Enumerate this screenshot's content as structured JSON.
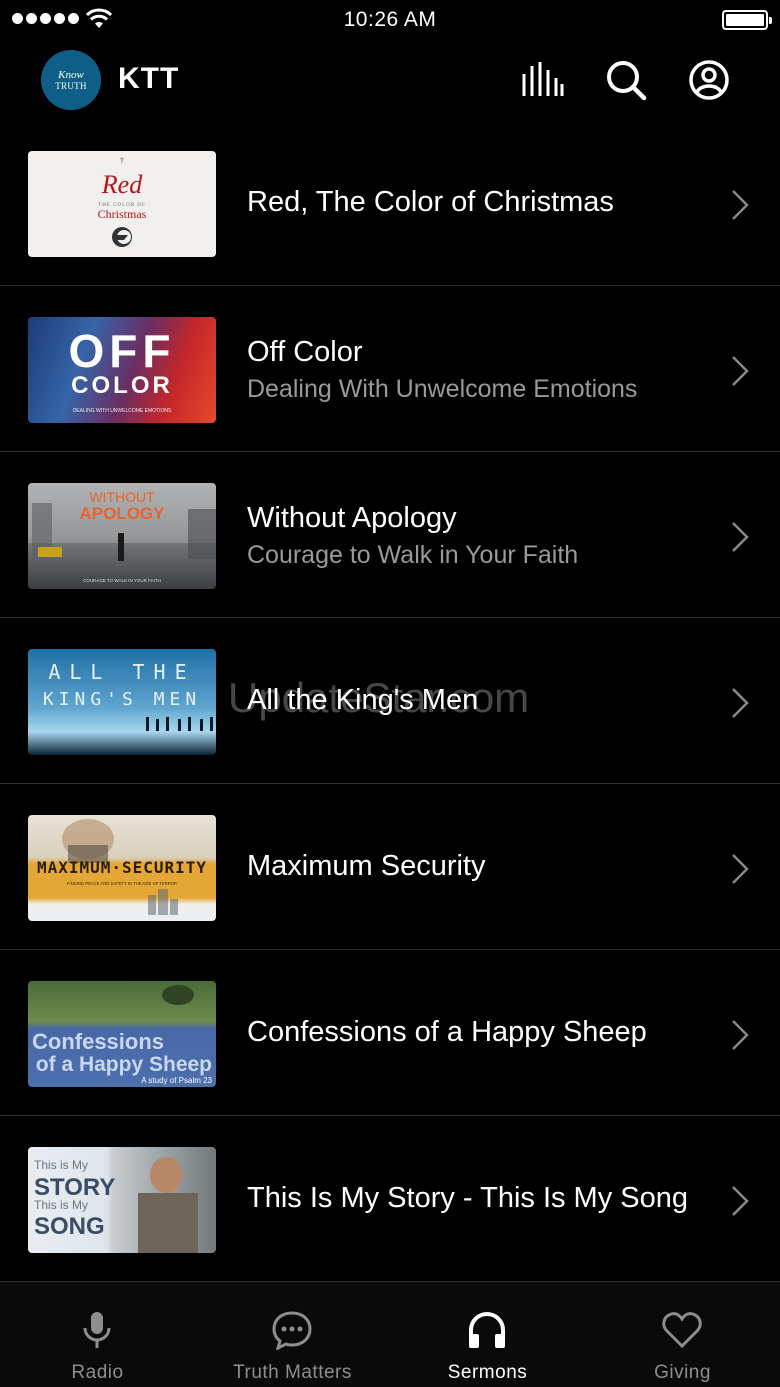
{
  "status_bar": {
    "time": "10:26 AM"
  },
  "header": {
    "logo_line1": "Know",
    "logo_line2": "TRUTH",
    "app_title": "KTT"
  },
  "icons": {
    "equalizer": "equalizer-icon",
    "search": "search-icon",
    "account": "account-icon",
    "chevron": "chevron-right-icon"
  },
  "sermons": [
    {
      "title": "Red, The Color of Christmas",
      "subtitle": "",
      "thumb": {
        "line1": "Red",
        "line2": "THE COLOR OF",
        "line3": "Christmas"
      }
    },
    {
      "title": "Off Color",
      "subtitle": "Dealing With Unwelcome Emotions",
      "thumb": {
        "line1": "OFF",
        "line2": "COLOR",
        "line3": "DEALING WITH UNWELCOME EMOTIONS"
      }
    },
    {
      "title": "Without Apology",
      "subtitle": "Courage to Walk in Your Faith",
      "thumb": {
        "line1": "WITHOUT",
        "line2": "APOLOGY",
        "line3": "COURAGE TO WALK IN YOUR FAITH"
      }
    },
    {
      "title": "All the King's Men",
      "subtitle": "",
      "thumb": {
        "line1": "ALL THE",
        "line2": "KING'S MEN"
      }
    },
    {
      "title": "Maximum Security",
      "subtitle": "",
      "thumb": {
        "line1": "MAXIMUM·SECURITY",
        "line2": "FINDING PEACE AND SAFETY IN THE AGE OF TERROR"
      }
    },
    {
      "title": "Confessions of a Happy Sheep",
      "subtitle": "",
      "thumb": {
        "line1": "Confessions",
        "line2": "of a Happy Sheep",
        "line3": "A study of Psalm 23"
      }
    },
    {
      "title": "This Is My Story - This Is My Song",
      "subtitle": "",
      "thumb": {
        "line1": "This is My",
        "line2": "STORY",
        "line3": "This is My",
        "line4": "SONG"
      }
    }
  ],
  "watermark": "UpdateStar.com",
  "tabs": [
    {
      "label": "Radio",
      "icon": "microphone-icon",
      "active": false
    },
    {
      "label": "Truth Matters",
      "icon": "chat-bubble-icon",
      "active": false
    },
    {
      "label": "Sermons",
      "icon": "headphones-icon",
      "active": true
    },
    {
      "label": "Giving",
      "icon": "heart-icon",
      "active": false
    }
  ],
  "colors": {
    "background": "#000000",
    "active_tab": "#ffffff",
    "inactive_tab": "#8e8e8e",
    "logo": "#0d5f88"
  }
}
